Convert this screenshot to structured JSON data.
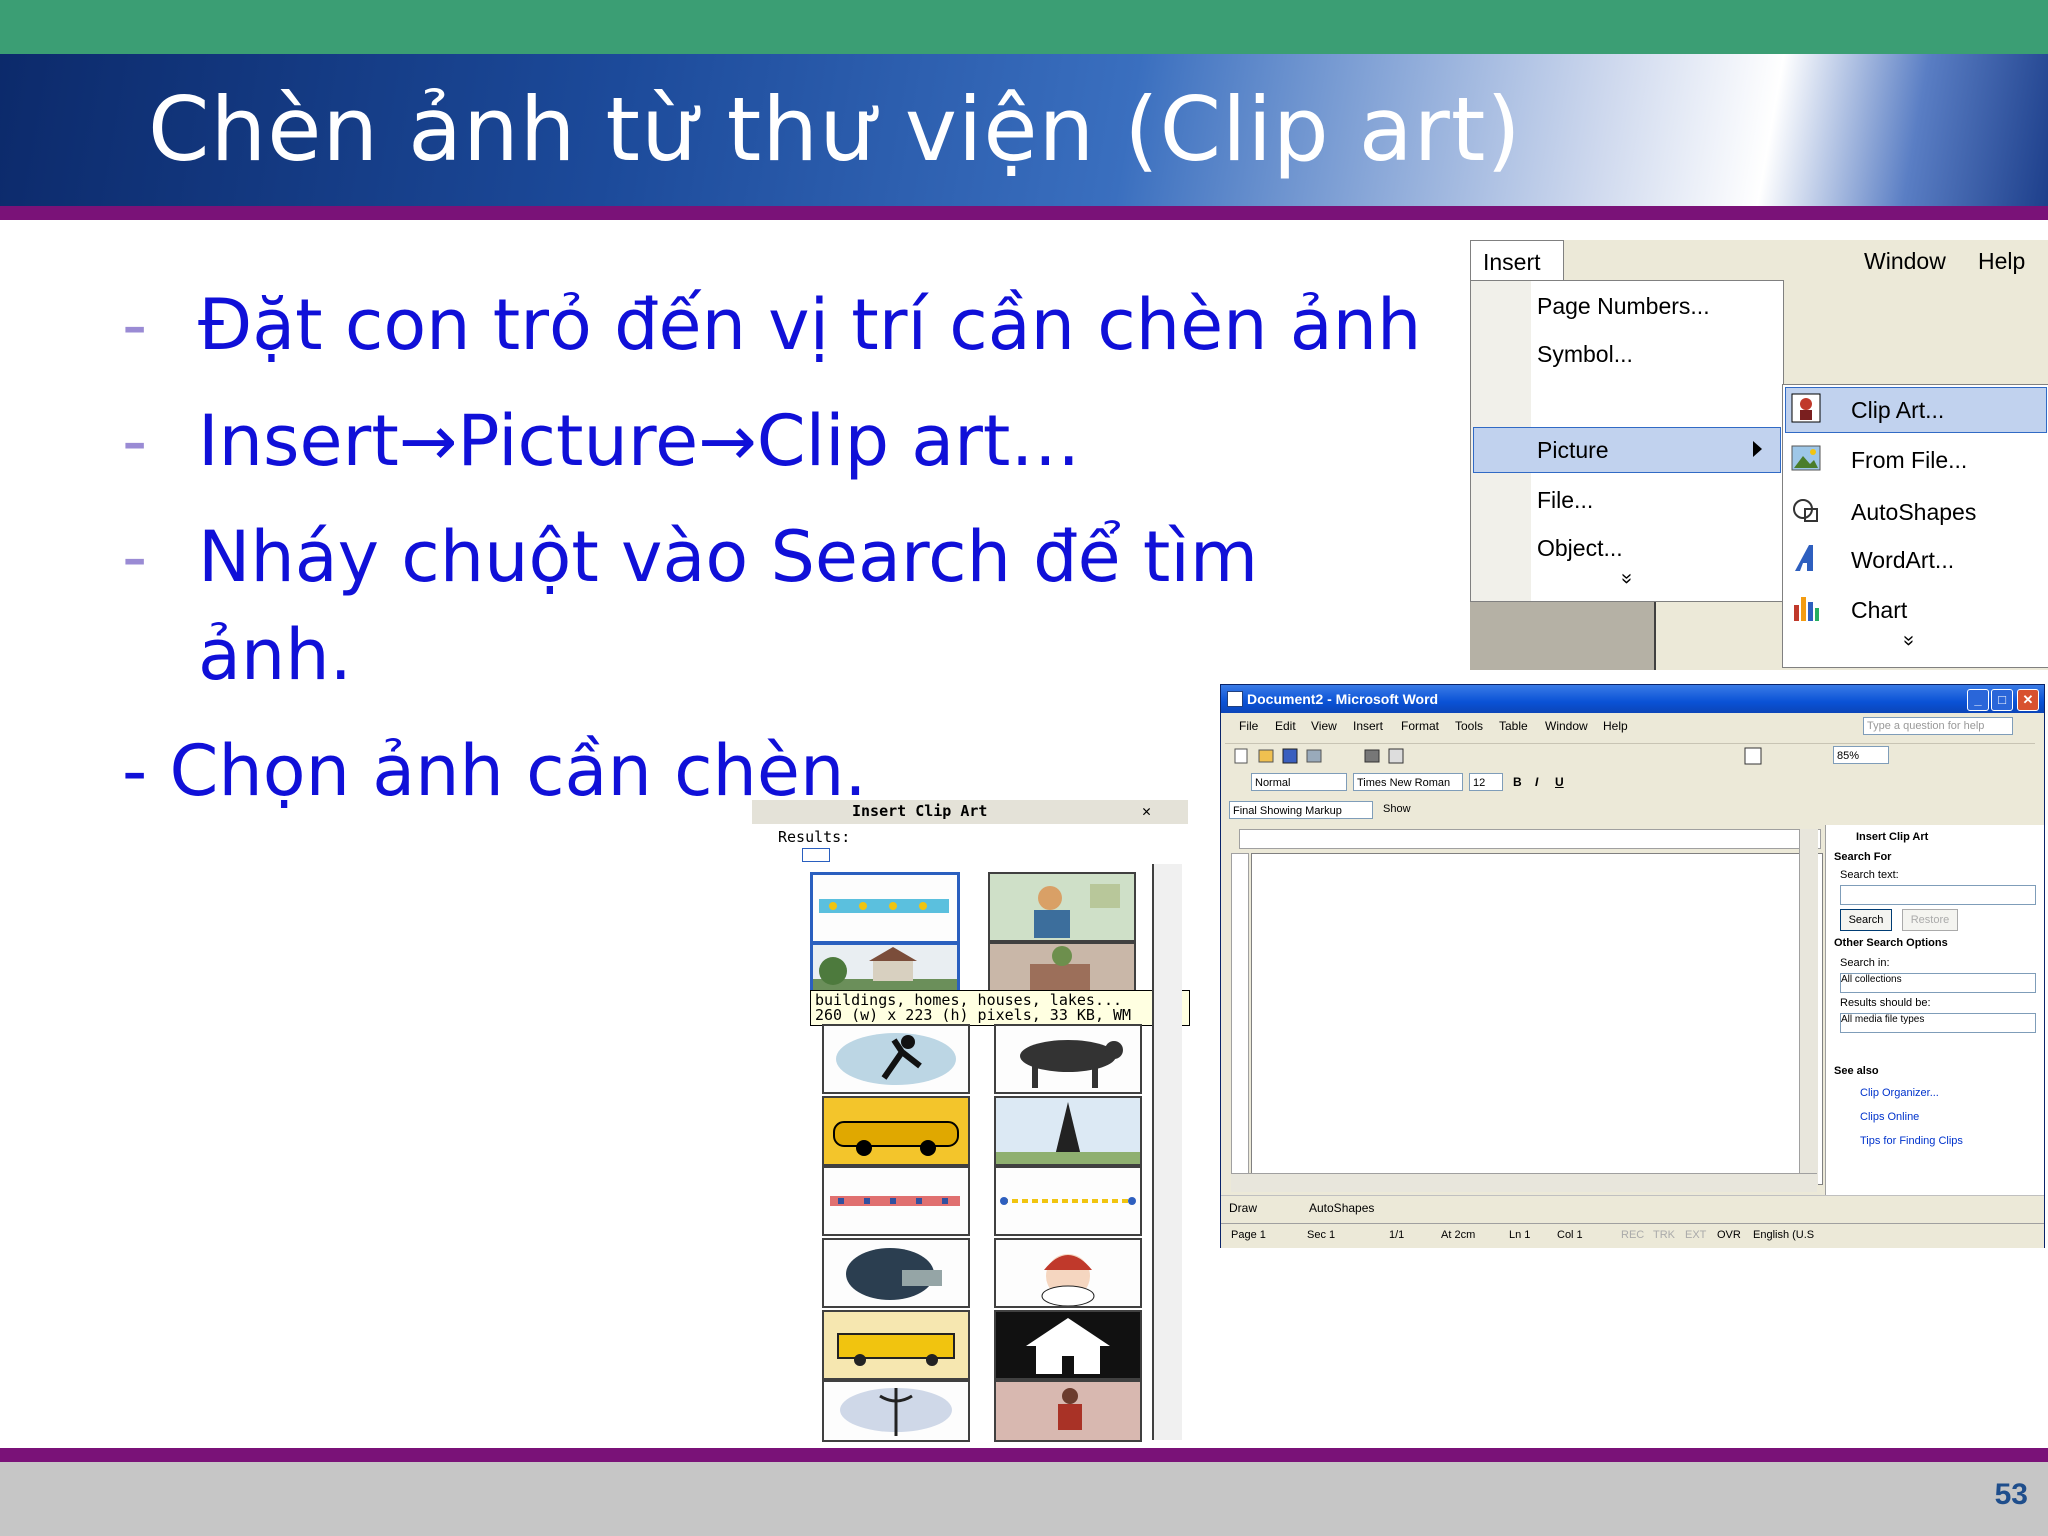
{
  "slide": {
    "title": "Chèn ảnh từ thư viện (Clip art)",
    "bullets": [
      {
        "dash": "-",
        "text": "Đặt con trỏ đến vị trí cần chèn ảnh"
      },
      {
        "dash": "-",
        "text": "Insert→Picture→Clip art…"
      },
      {
        "dash": "-",
        "text": "Nháy chuột vào Search để tìm"
      },
      {
        "dash": "",
        "text": "ảnh."
      },
      {
        "dash": "",
        "text": "- Chọn ảnh cần chèn."
      }
    ],
    "page_number": "53",
    "colors": {
      "header_green": "#3b9e74",
      "accent_purple": "#7a1278",
      "bullet_blue": "#1010d8",
      "footer_grey": "#c6c6c6"
    }
  },
  "insert_menu": {
    "menubar": {
      "insert": "Insert",
      "window": "Window",
      "help": "Help"
    },
    "items": [
      "Page Numbers...",
      "Symbol...",
      "Picture",
      "File...",
      "Object..."
    ],
    "expand": "»",
    "submenu": [
      "Clip Art...",
      "From File...",
      "AutoShapes",
      "WordArt...",
      "Chart"
    ],
    "submenu_icons": [
      "clip-art-icon",
      "from-file-icon",
      "autoshapes-icon",
      "wordart-icon",
      "chart-icon"
    ],
    "submenu_expand": "»"
  },
  "word": {
    "title": "Document2 - Microsoft Word",
    "menus": [
      "File",
      "Edit",
      "View",
      "Insert",
      "Format",
      "Tools",
      "Table",
      "Window",
      "Help"
    ],
    "help_box": "Type a question for help",
    "style": "Normal",
    "font": "Times New Roman",
    "size": "12",
    "zoom": "85%",
    "markup": "Final Showing Markup",
    "show": "Show",
    "taskpane": {
      "title": "Insert Clip Art",
      "search_for": "Search For",
      "search_text": "Search text:",
      "search_btn": "Search",
      "restore_btn": "Restore",
      "other": "Other Search Options",
      "search_in": "Search in:",
      "search_in_val": "All collections",
      "results_be": "Results should be:",
      "results_val": "All media file types",
      "see_also": "See also",
      "links": [
        "Clip Organizer...",
        "Clips Online",
        "Tips for Finding Clips"
      ]
    },
    "draw": {
      "draw": "Draw",
      "autoshapes": "AutoShapes"
    },
    "status": [
      "Page 1",
      "Sec 1",
      "1/1",
      "At 2cm",
      "Ln 1",
      "Col 1",
      "REC",
      "TRK",
      "EXT",
      "OVR",
      "English (U.S"
    ]
  },
  "clip_pane": {
    "title": "Insert Clip Art",
    "results": "Results:",
    "tooltip_line1": "buildings, homes, houses, lakes...",
    "tooltip_line2": "260 (w) x 223 (h) pixels, 33 KB, WM"
  }
}
